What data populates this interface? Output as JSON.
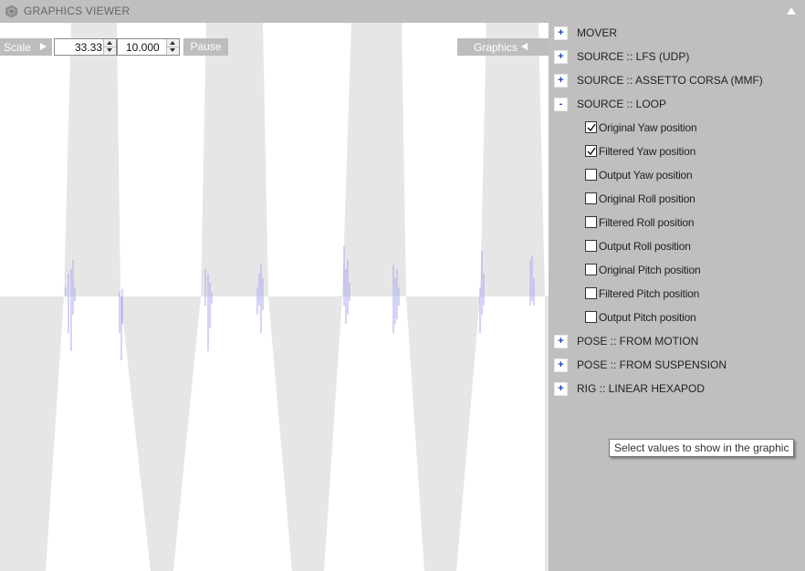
{
  "window": {
    "title": "GRAPHICS VIEWER"
  },
  "toolbar": {
    "scale_label": "Scale",
    "scale_value": "33.33",
    "second_value": "10.000",
    "pause_label": "Pause",
    "graphics_label": "Graphics"
  },
  "tree": {
    "nodes": [
      {
        "label": "MOVER",
        "expander": "+"
      },
      {
        "label": "SOURCE :: LFS (UDP)",
        "expander": "+"
      },
      {
        "label": "SOURCE :: ASSETTO CORSA (MMF)",
        "expander": "+"
      },
      {
        "label": "SOURCE :: LOOP",
        "expander": "-"
      },
      {
        "label": "POSE :: FROM MOTION",
        "expander": "+"
      },
      {
        "label": "POSE :: FROM SUSPENSION",
        "expander": "+"
      },
      {
        "label": "RIG :: LINEAR HEXAPOD",
        "expander": "+"
      }
    ],
    "loop_children": [
      {
        "label": "Original Yaw position",
        "checked": true
      },
      {
        "label": "Filtered Yaw position",
        "checked": true
      },
      {
        "label": "Output Yaw position",
        "checked": false
      },
      {
        "label": "Original Roll position",
        "checked": false
      },
      {
        "label": "Filtered Roll position",
        "checked": false
      },
      {
        "label": "Output Roll position",
        "checked": false
      },
      {
        "label": "Original Pitch position",
        "checked": false
      },
      {
        "label": "Filtered Pitch position",
        "checked": false
      },
      {
        "label": "Output Pitch position",
        "checked": false
      }
    ]
  },
  "tooltip": {
    "text": "Select values to show in the graphic"
  },
  "colors": {
    "fill_band": "#e6e6e6",
    "trace": "#a9a9f0",
    "accent": "#1d3fb3",
    "panel": "#bfbfbf"
  }
}
